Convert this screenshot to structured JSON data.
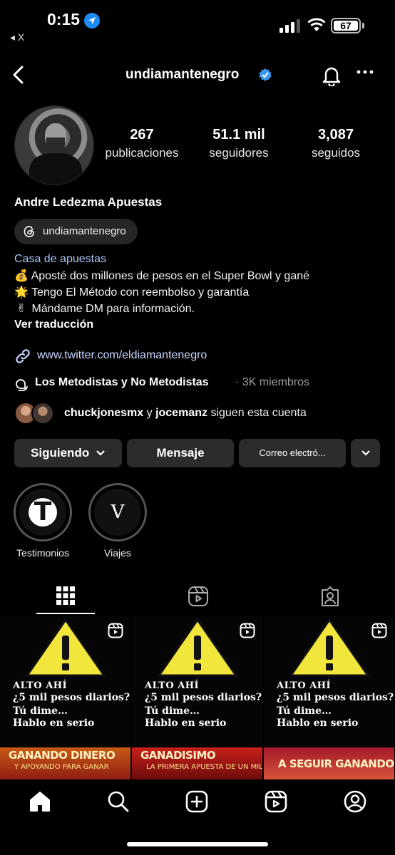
{
  "status_bar": {
    "time": "0:15",
    "battery": "67",
    "back_app": "◂ X"
  },
  "header": {
    "username": "undiamantenegro"
  },
  "profile": {
    "stats": [
      {
        "value": "267",
        "label": "publicaciones"
      },
      {
        "value": "51.1 mil",
        "label": "seguidores"
      },
      {
        "value": "3,087",
        "label": "seguidos"
      }
    ],
    "full_name": "Andre Ledezma Apuestas",
    "threads_handle": "undiamantenegro",
    "category": "Casa de apuestas",
    "bio_lines": [
      {
        "emoji": "💰",
        "text": "Aposté dos millones de pesos en el Super Bowl y gané"
      },
      {
        "emoji": "🌟",
        "text": "Tengo El Método con reembolso y garantía"
      },
      {
        "emoji": "✌",
        "text": "Mándame DM para información."
      }
    ],
    "translate": "Ver traducción",
    "link": "www.twitter.com/eldiamantenegro",
    "community": {
      "name": "Los Metodistas y No Metodistas",
      "meta": "· 3K miembros"
    },
    "followed_by": {
      "user1": "chuckjonesmx",
      "conj": "y",
      "user2": "jocemanz",
      "suffix": "siguen esta cuenta"
    }
  },
  "actions": {
    "following": "Siguiendo",
    "message": "Mensaje",
    "email": "Correo electró..."
  },
  "highlights": [
    {
      "label": "Testimonios",
      "letter": "T"
    },
    {
      "label": "Viajes",
      "letter": "V"
    }
  ],
  "posts": [
    {
      "l1": "ALTO AHÍ",
      "l2": "¿5 mil pesos diarios?",
      "l3": "Tú dime…",
      "l4": "Hablo en serio"
    },
    {
      "l1": "ALTO AHÍ",
      "l2": "¿5 mil pesos diarios?",
      "l3": "Tú dime…",
      "l4": "Hablo en serio"
    },
    {
      "l1": "ALTO AHÍ",
      "l2": "¿5 mil pesos diarios?",
      "l3": "Tú dime…",
      "l4": "Hablo en serio"
    }
  ],
  "posts_row2": [
    {
      "title": "GANANDO DINERO",
      "sub": "Y APOYANDO PARA GANAR"
    },
    {
      "title": "GANADISIMO",
      "sub": "LA PRIMERA APUESTA DE UN MILLON"
    },
    {
      "title": "A SEGUIR GANANDO",
      "sub": ""
    }
  ],
  "colors": {
    "accent_link": "#c7d8ff",
    "category": "#a8c7fa",
    "verified": "#3897f0",
    "button_bg": "#2c2c2c"
  }
}
